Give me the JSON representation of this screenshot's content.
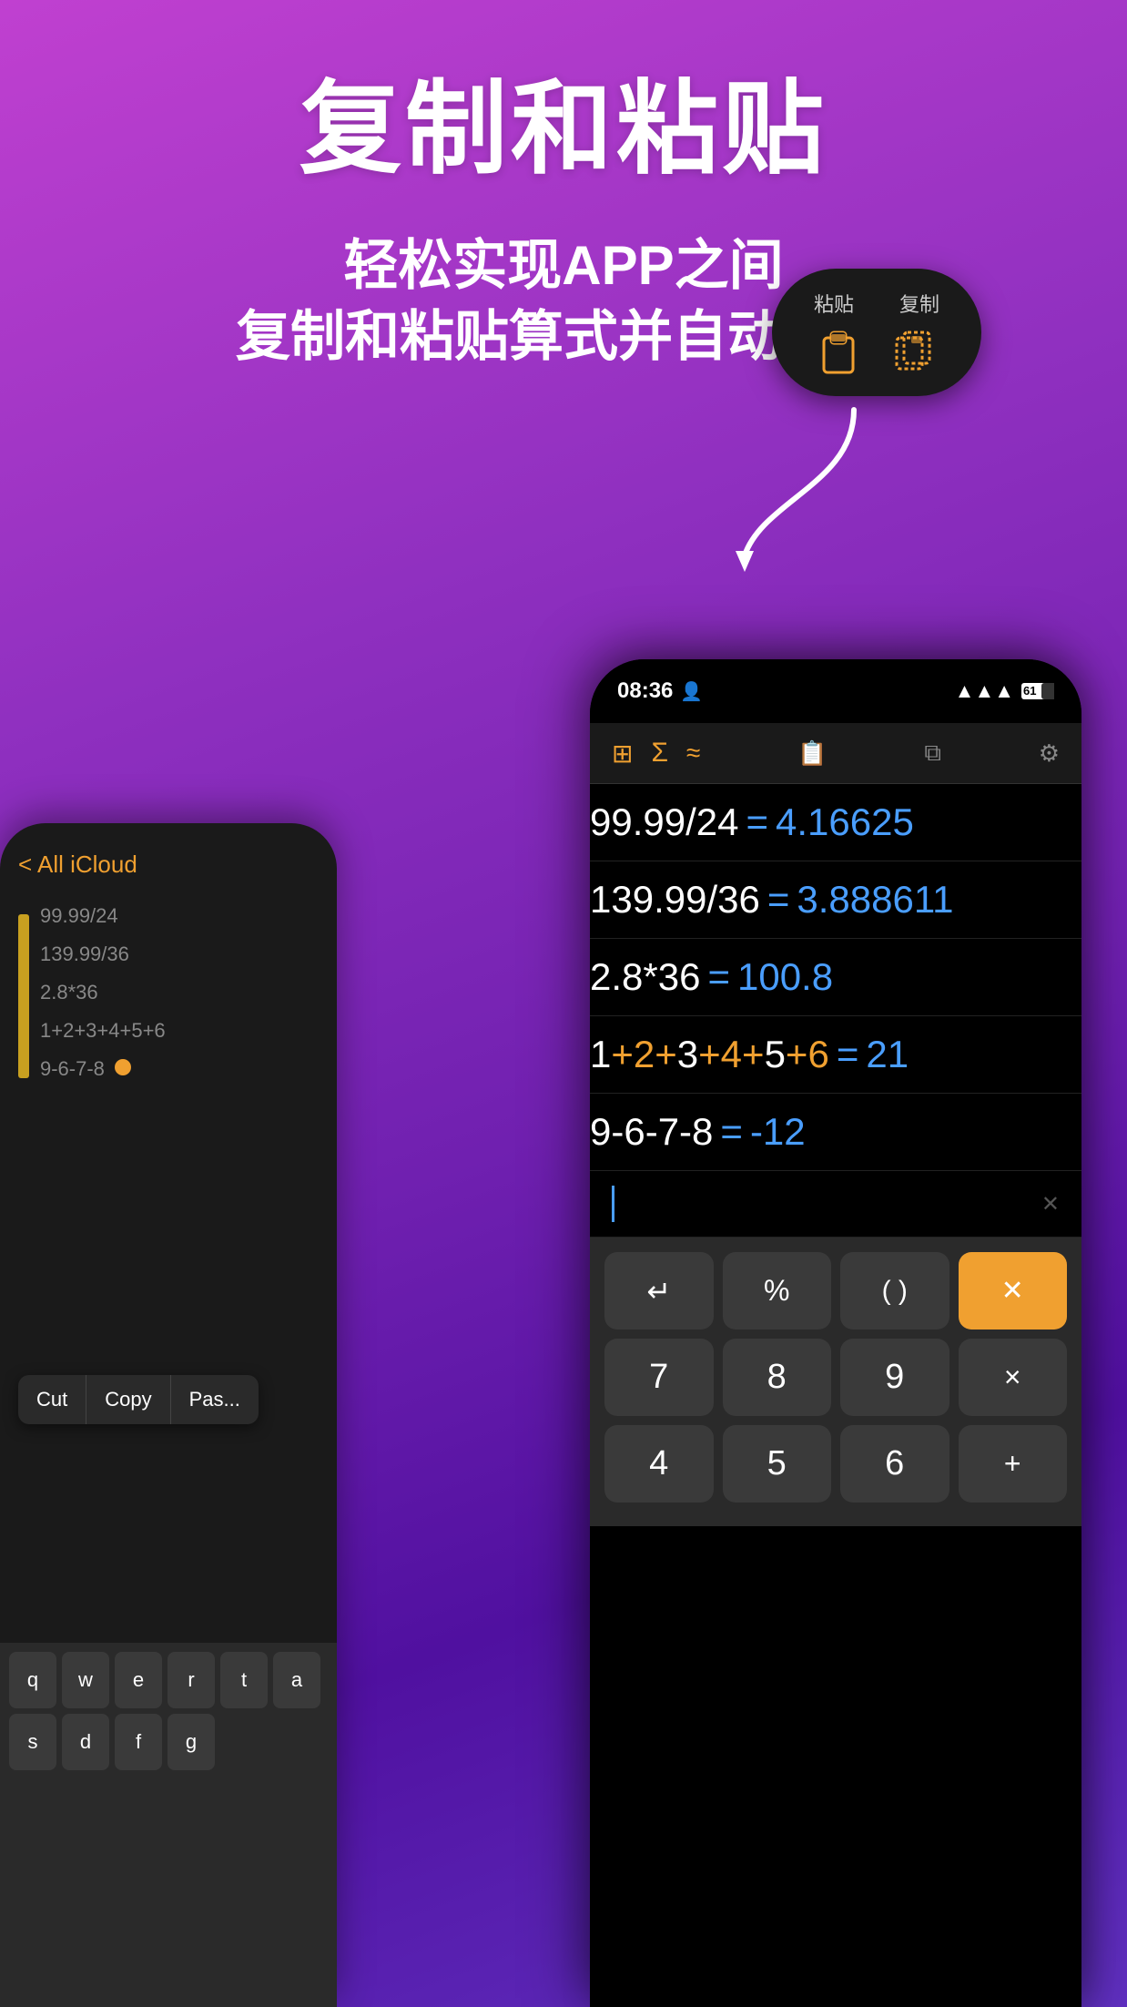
{
  "header": {
    "main_title": "复制和粘贴",
    "subtitle_1": "轻松实现APP之间",
    "subtitle_2": "复制和粘贴算式并自动运算"
  },
  "floating_menu": {
    "paste_label": "粘贴",
    "copy_label": "复制"
  },
  "bg_phone": {
    "nav_back": "< All iCloud",
    "list_items": [
      "99.99/24",
      "139.99/36",
      "2.8*36",
      "1+2+3+4+5+6",
      "9-6-7-8"
    ],
    "cut_label": "Cut",
    "copy_label": "Copy",
    "paste_label": "Pas..."
  },
  "main_phone": {
    "status_time": "08:36",
    "battery_pct": "61",
    "calc_rows": [
      {
        "expression": "99.99/24",
        "equals": "=",
        "result": "4.16625"
      },
      {
        "expression": "139.99/36",
        "equals": "=",
        "result": "3.888611"
      },
      {
        "expression": "2.8*36",
        "equals": "=",
        "result": "100.8"
      },
      {
        "expression": "1+2+3+4+5+6",
        "equals": "=",
        "result": "21"
      },
      {
        "expression": "9-6-7-8",
        "equals": "=",
        "result": "-12"
      }
    ],
    "keyboard": {
      "row1": [
        "↵",
        "%",
        "( )",
        "⌫"
      ],
      "row2": [
        "7",
        "8",
        "9",
        "×"
      ],
      "row3": [
        "4",
        "5",
        "6",
        "+"
      ]
    }
  }
}
